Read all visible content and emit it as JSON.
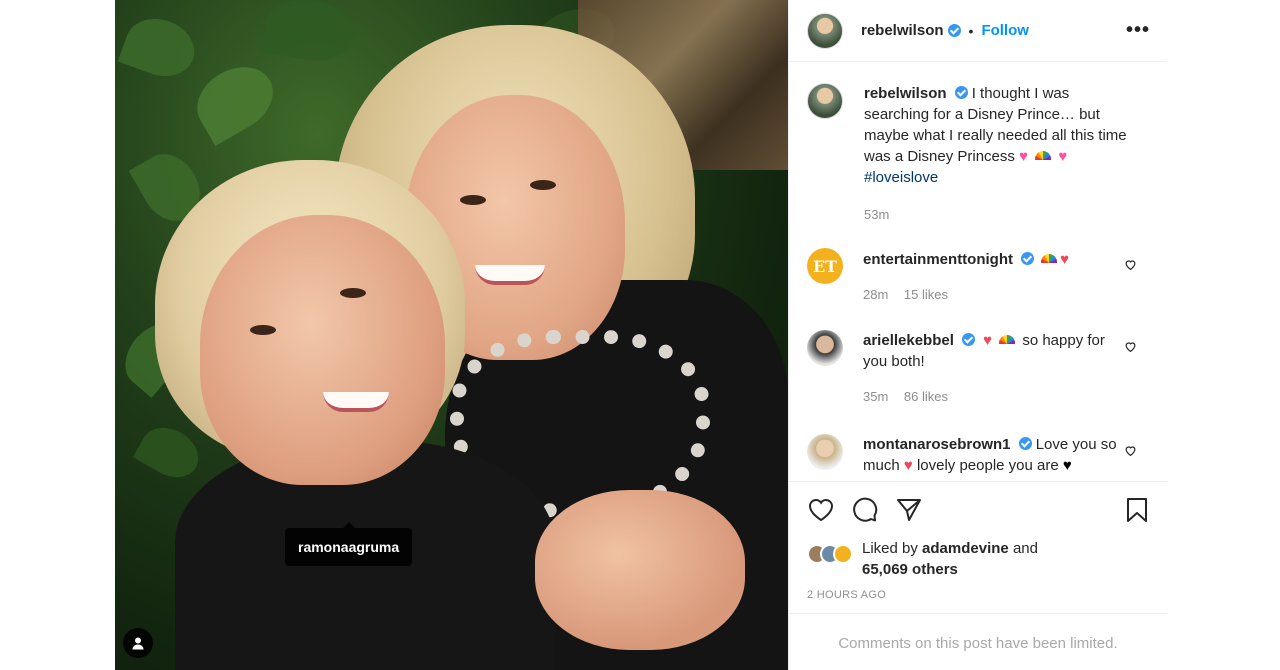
{
  "post": {
    "tagged_user": "ramonaagruma"
  },
  "header": {
    "username": "rebelwilson",
    "separator": "•",
    "follow_label": "Follow",
    "more_label": "•••"
  },
  "caption": {
    "username": "rebelwilson",
    "text": "I thought I was searching for a Disney Prince… but maybe what I really needed all this time was a Disney Princess",
    "hashtag": "#loveislove",
    "time": "53m"
  },
  "comments": [
    {
      "username": "entertainmenttonight",
      "avatar_text": "ET",
      "text": "",
      "time": "28m",
      "likes": "15 likes"
    },
    {
      "username": "ariellekebbel",
      "text": "so happy for you both!",
      "time": "35m",
      "likes": "86 likes"
    },
    {
      "username": "montanarosebrown1",
      "text_a": "Love you so much",
      "text_b": "lovely people you are"
    }
  ],
  "likes": {
    "prefix": "Liked by",
    "user": "adamdevine",
    "suffix": "and",
    "others": "65,069 others"
  },
  "timestamp": "2 HOURS AGO",
  "limited_notice": "Comments on this post have been limited.",
  "icons": [
    "heart-icon",
    "comment-icon",
    "share-icon",
    "bookmark-icon",
    "user-tag-icon",
    "verified-badge-icon"
  ],
  "colors": {
    "link_blue": "#0095f6",
    "verified": "#3897f0",
    "muted": "#8e8e8e",
    "heart_red": "#ed4956",
    "et_gold": "#f3b21d"
  }
}
